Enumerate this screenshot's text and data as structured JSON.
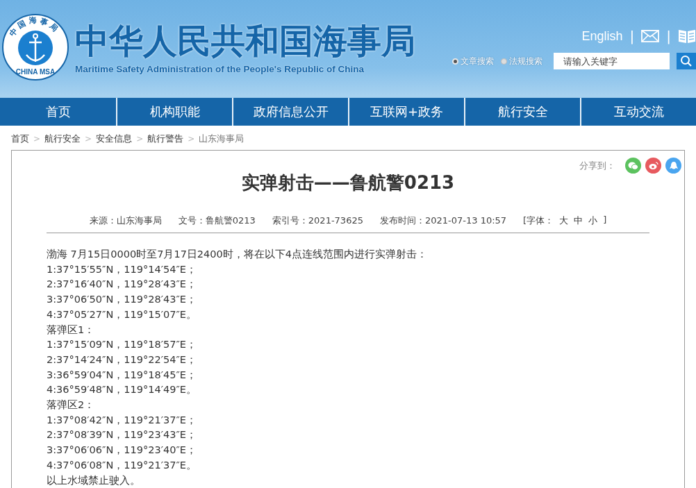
{
  "header": {
    "logo": {
      "ring_text": "中国海事局",
      "bottom_text": "CHINA MSA"
    },
    "title": "中华人民共和国海事局",
    "subtitle": "Maritime Safety Administration of the People's Republic of China",
    "english_link": "English",
    "divider": "|",
    "search_types": [
      {
        "label": "文章搜索",
        "selected": true
      },
      {
        "label": "法规搜索",
        "selected": false
      }
    ],
    "search": {
      "placeholder": "请输入关键字"
    }
  },
  "nav": [
    {
      "label": "首页"
    },
    {
      "label": "机构职能"
    },
    {
      "label": "政府信息公开"
    },
    {
      "label": "互联网+政务"
    },
    {
      "label": "航行安全"
    },
    {
      "label": "互动交流"
    }
  ],
  "breadcrumb": {
    "separator": ">",
    "items": [
      "首页",
      "航行安全",
      "安全信息",
      "航行警告",
      "山东海事局"
    ]
  },
  "article": {
    "share_label": "分享到：",
    "title": "实弹射击——鲁航警0213",
    "meta": [
      "来源：山东海事局",
      "文号：鲁航警0213",
      "索引号：2021-73625",
      "发布时间：2021-07-13 10:57"
    ],
    "font_size": {
      "open": "[字体：",
      "options": [
        "大",
        "中",
        "小"
      ],
      "close": "]"
    },
    "paragraphs": [
      "渤海 7月15日0000时至7月17日2400时，将在以下4点连线范围内进行实弹射击：",
      "1:37°15′55″N，119°14′54″E；",
      "2:37°16′40″N，119°28′43″E；",
      "3:37°06′50″N，119°28′43″E；",
      "4:37°05′27″N，119°15′07″E。",
      "落弹区1：",
      "1:37°15′09″N，119°18′57″E；",
      "2:37°14′24″N，119°22′54″E；",
      "3:36°59′04″N，119°18′45″E；",
      "4:36°59′48″N，119°14′49″E。",
      "落弹区2：",
      "1:37°08′42″N，119°21′37″E；",
      "2:37°08′39″N，119°23′43″E；",
      "3:37°06′06″N，119°23′40″E；",
      "4:37°06′08″N，119°21′37″E。",
      "以上水域禁止驶入。"
    ]
  }
}
